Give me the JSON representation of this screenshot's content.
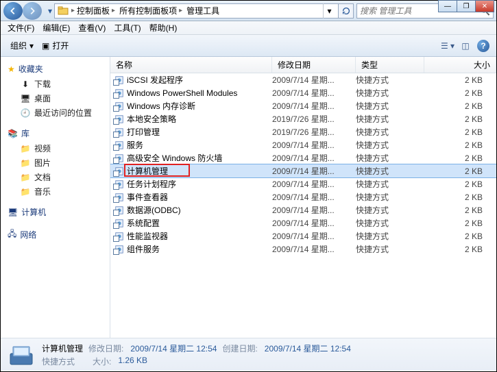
{
  "titlebar": {
    "breadcrumb": [
      "控制面板",
      "所有控制面板项",
      "管理工具"
    ],
    "search_placeholder": "搜索 管理工具"
  },
  "window_buttons": {
    "min": "—",
    "max": "❐",
    "close": "✕"
  },
  "menubar": [
    "文件(F)",
    "编辑(E)",
    "查看(V)",
    "工具(T)",
    "帮助(H)"
  ],
  "toolbar": {
    "organize": "组织",
    "open": "打开"
  },
  "sidebar": {
    "favorites": {
      "label": "收藏夹",
      "items": [
        "下载",
        "桌面",
        "最近访问的位置"
      ]
    },
    "libraries": {
      "label": "库",
      "items": [
        "视频",
        "图片",
        "文档",
        "音乐"
      ]
    },
    "computer": {
      "label": "计算机"
    },
    "network": {
      "label": "网络"
    }
  },
  "columns": {
    "name": "名称",
    "date": "修改日期",
    "type": "类型",
    "size": "大小"
  },
  "files": [
    {
      "name": "iSCSI 发起程序",
      "date": "2009/7/14 星期...",
      "type": "快捷方式",
      "size": "2 KB"
    },
    {
      "name": "Windows PowerShell Modules",
      "date": "2009/7/14 星期...",
      "type": "快捷方式",
      "size": "2 KB"
    },
    {
      "name": "Windows 内存诊断",
      "date": "2009/7/14 星期...",
      "type": "快捷方式",
      "size": "2 KB"
    },
    {
      "name": "本地安全策略",
      "date": "2019/7/26 星期...",
      "type": "快捷方式",
      "size": "2 KB"
    },
    {
      "name": "打印管理",
      "date": "2019/7/26 星期...",
      "type": "快捷方式",
      "size": "2 KB"
    },
    {
      "name": "服务",
      "date": "2009/7/14 星期...",
      "type": "快捷方式",
      "size": "2 KB"
    },
    {
      "name": "高级安全 Windows 防火墙",
      "date": "2009/7/14 星期...",
      "type": "快捷方式",
      "size": "2 KB"
    },
    {
      "name": "计算机管理",
      "date": "2009/7/14 星期...",
      "type": "快捷方式",
      "size": "2 KB",
      "selected": true,
      "highlighted": true
    },
    {
      "name": "任务计划程序",
      "date": "2009/7/14 星期...",
      "type": "快捷方式",
      "size": "2 KB"
    },
    {
      "name": "事件查看器",
      "date": "2009/7/14 星期...",
      "type": "快捷方式",
      "size": "2 KB"
    },
    {
      "name": "数据源(ODBC)",
      "date": "2009/7/14 星期...",
      "type": "快捷方式",
      "size": "2 KB"
    },
    {
      "name": "系统配置",
      "date": "2009/7/14 星期...",
      "type": "快捷方式",
      "size": "2 KB"
    },
    {
      "name": "性能监视器",
      "date": "2009/7/14 星期...",
      "type": "快捷方式",
      "size": "2 KB"
    },
    {
      "name": "组件服务",
      "date": "2009/7/14 星期...",
      "type": "快捷方式",
      "size": "2 KB"
    }
  ],
  "details": {
    "title": "计算机管理",
    "mod_label": "修改日期:",
    "mod_val": "2009/7/14 星期二 12:54",
    "create_label": "创建日期:",
    "create_val": "2009/7/14 星期二 12:54",
    "type": "快捷方式",
    "size_label": "大小:",
    "size_val": "1.26 KB"
  }
}
